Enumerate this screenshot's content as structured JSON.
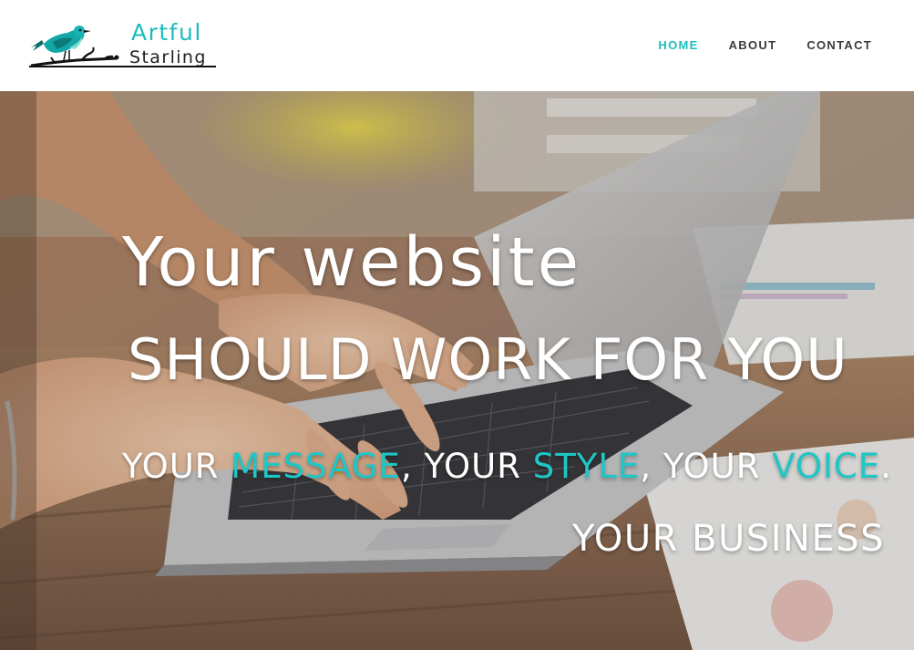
{
  "brand": {
    "word1": "Artful",
    "word2": "Starling",
    "accent_color": "#1dbdbd",
    "icon": "bird-on-branch-icon"
  },
  "nav": {
    "items": [
      {
        "label": "HOME",
        "active": true
      },
      {
        "label": "ABOUT",
        "active": false
      },
      {
        "label": "CONTACT",
        "active": false
      }
    ]
  },
  "hero": {
    "line1": "Your website",
    "line2": "SHOULD WORK FOR YOU",
    "line3": {
      "p1": "YOUR ",
      "w1": "MESSAGE",
      "p2": ", YOUR ",
      "w2": "STYLE",
      "p3": ", YOUR ",
      "w3": "VOICE",
      "p4": "."
    },
    "line4": "YOUR BUSINESS",
    "background": "laptop-typing-photo"
  }
}
